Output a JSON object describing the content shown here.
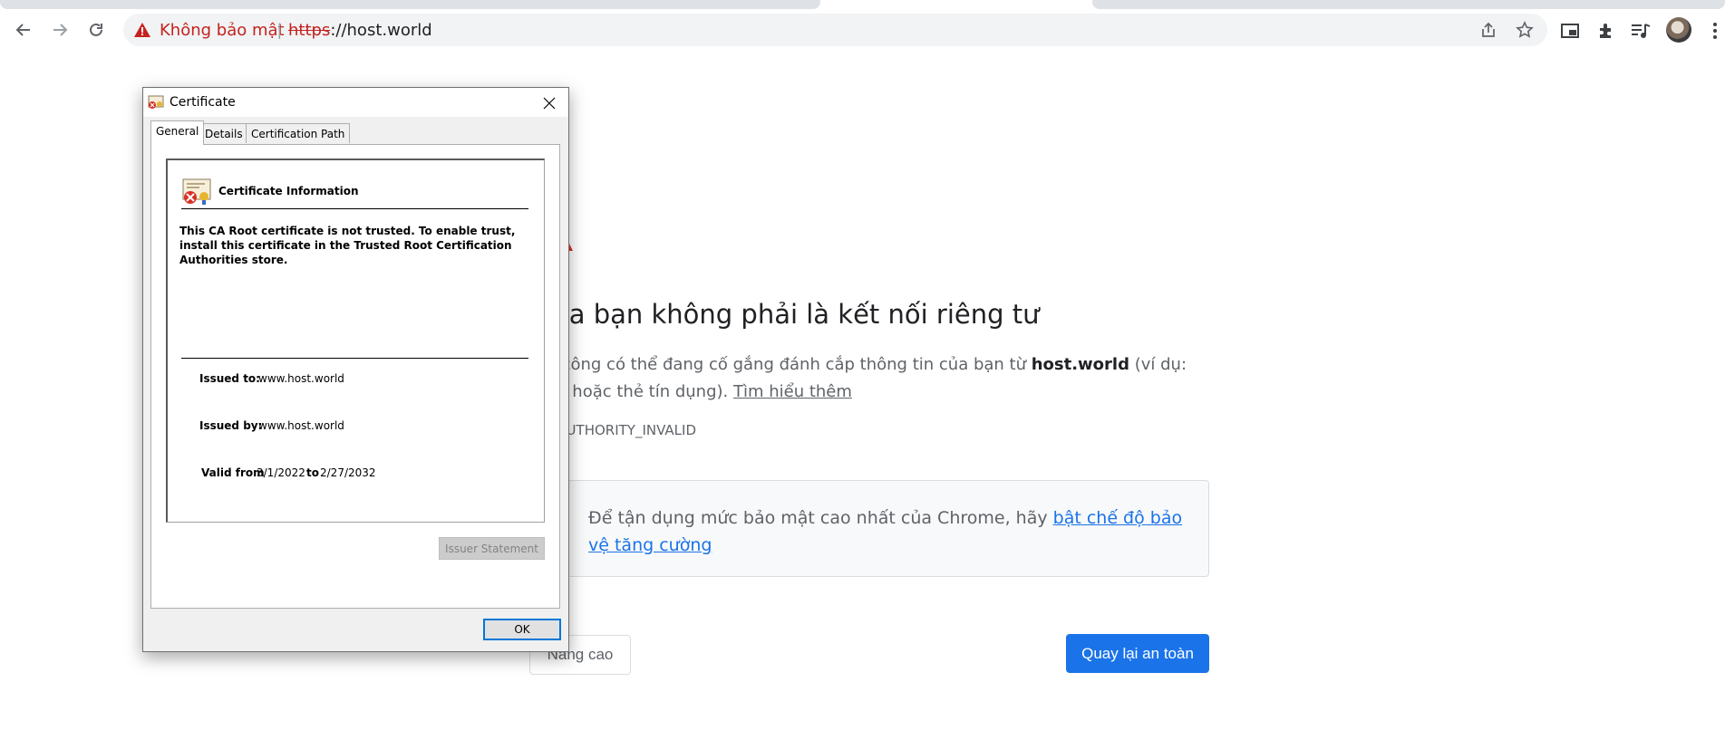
{
  "browser": {
    "omnibox": {
      "not_secure_label": "Không bảo mật",
      "separator": "|",
      "url_scheme": "https",
      "url_rest": "://host.world"
    },
    "icons": [
      "back-arrow-icon",
      "forward-arrow-icon",
      "reload-icon",
      "warning-triangle-icon",
      "share-icon",
      "star-icon",
      "picture-in-picture-icon",
      "extensions-icon",
      "media-control-icon",
      "profile-avatar",
      "menu-dots-icon"
    ],
    "colors": {
      "not_secure_red": "#c5221f",
      "omnibox_bg": "#f1f3f4"
    }
  },
  "interstitial": {
    "heading": "nối của bạn không phải là kết nối riêng tư",
    "body_line1_prefix": "g kẻ tấn công có thể đang cố gắng đánh cắp thông tin của bạn từ ",
    "body_host": "host.world",
    "body_line1_suffix": " (ví dụ:",
    "body_line2_prefix": "khẩu, thư hoặc thẻ tín dụng). ",
    "learn_more_link": "Tìm hiểu thêm",
    "error_code": "RR_CERT_AUTHORITY_INVALID",
    "enhanced_text": "Để tận dụng mức bảo mật cao nhất của Chrome, hãy ",
    "enhanced_link": "bật chế độ bảo vệ tăng cường",
    "advanced_button": "Nâng cao",
    "back_button": "Quay lại an toàn",
    "colors": {
      "primary_blue": "#1a73e8",
      "warning_red": "#d93025"
    }
  },
  "certificate_dialog": {
    "title": "Certificate",
    "tabs": [
      {
        "label": "General"
      },
      {
        "label": "Details"
      },
      {
        "label": "Certification Path"
      }
    ],
    "info_heading": "Certificate Information",
    "not_trusted_message": "This CA Root certificate is not trusted. To enable trust, install this certificate in the Trusted Root Certification Authorities store.",
    "issued_to_label": "Issued to:",
    "issued_to_value": "www.host.world",
    "issued_by_label": "Issued by:",
    "issued_by_value": "www.host.world",
    "valid_from_label": "Valid from",
    "valid_from_value": "3/1/2022",
    "valid_to_label": "to",
    "valid_to_value": "2/27/2032",
    "issuer_statement_button": "Issuer Statement",
    "ok_button": "OK"
  }
}
